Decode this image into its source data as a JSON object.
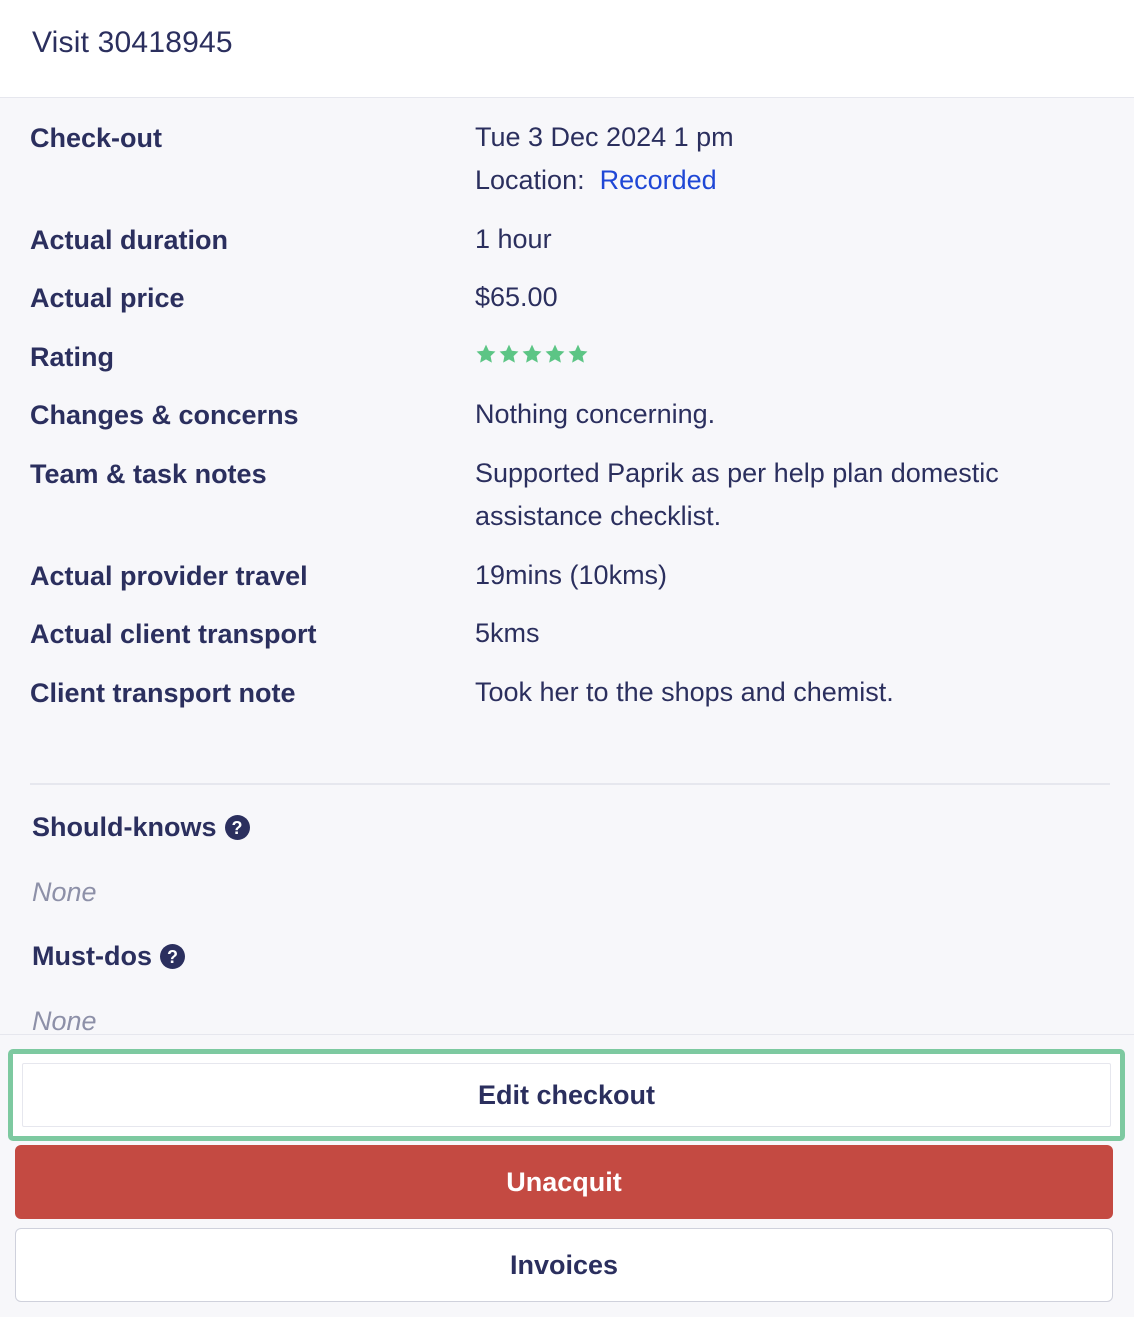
{
  "header": {
    "title": "Visit 30418945"
  },
  "details": [
    {
      "label": "Check-out",
      "value": "Tue 3 Dec 2024 1 pm",
      "location_label": "Location:",
      "location_link": "Recorded"
    },
    {
      "label": "Actual duration",
      "value": "1 hour"
    },
    {
      "label": "Actual price",
      "value": "$65.00"
    },
    {
      "label": "Rating",
      "rating": 5,
      "rating_max": 5,
      "star_color": "#5cc585"
    },
    {
      "label": "Changes & concerns",
      "value": "Nothing concerning."
    },
    {
      "label": "Team & task notes",
      "value": "Supported Paprik as per help plan domestic assistance checklist."
    },
    {
      "label": "Actual provider travel",
      "value": "19mins (10kms)"
    },
    {
      "label": "Actual client transport",
      "value": "5kms"
    },
    {
      "label": "Client transport note",
      "value": "Took her to the shops and chemist."
    }
  ],
  "should_knows": {
    "title": "Should-knows",
    "icon": "help-circle-icon",
    "value": "None"
  },
  "must_dos": {
    "title": "Must-dos",
    "icon": "help-circle-icon",
    "value": "None"
  },
  "actions": {
    "edit_checkout": "Edit checkout",
    "unacquit": "Unacquit",
    "invoices": "Invoices"
  },
  "colors": {
    "text": "#2b2f5e",
    "link": "#1f47d6",
    "danger": "#c44a42",
    "highlight": "#7dc9a0",
    "star": "#5cc585"
  }
}
